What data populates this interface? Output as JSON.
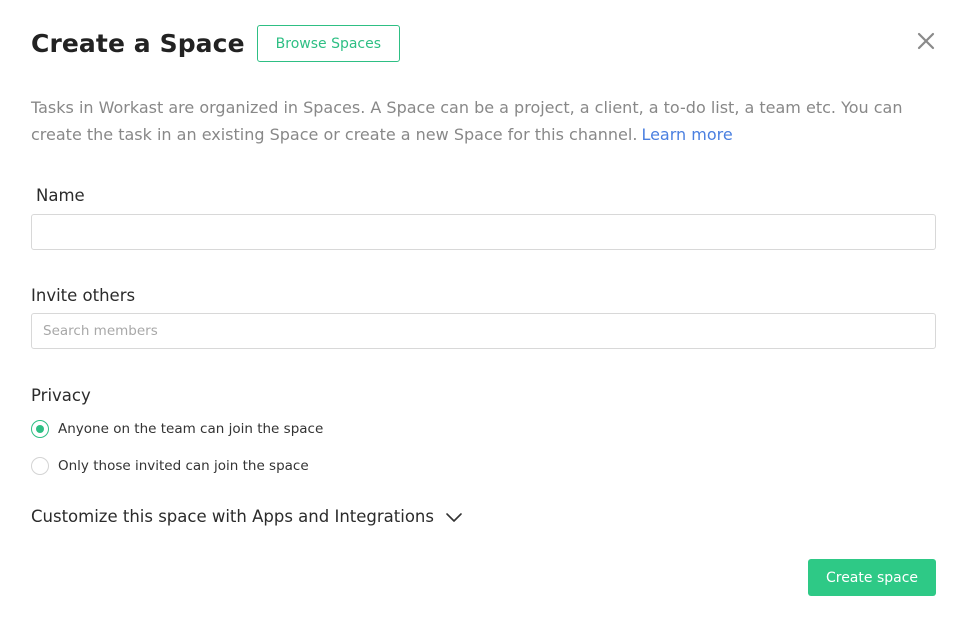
{
  "header": {
    "title": "Create a Space",
    "browse_label": "Browse Spaces",
    "close_icon": "close-icon"
  },
  "description": {
    "text": "Tasks in Workast are organized in Spaces. A Space can be a project, a client, a to-do list, a team etc. You can create the task in an existing Space or create a new Space for this channel.",
    "link_text": "Learn more"
  },
  "name_field": {
    "label": "Name",
    "value": "",
    "placeholder": ""
  },
  "invite_field": {
    "label": "Invite others",
    "value": "",
    "placeholder": "Search members"
  },
  "privacy": {
    "label": "Privacy",
    "options": [
      {
        "label": "Anyone on the team can join the space",
        "selected": true
      },
      {
        "label": "Only those invited can join the space",
        "selected": false
      }
    ]
  },
  "customize": {
    "label": "Customize this space with Apps and Integrations",
    "icon": "chevron-down-icon"
  },
  "footer": {
    "create_label": "Create space"
  },
  "colors": {
    "accent": "#2ec986",
    "link": "#4a7fe0",
    "muted_text": "#888888"
  }
}
